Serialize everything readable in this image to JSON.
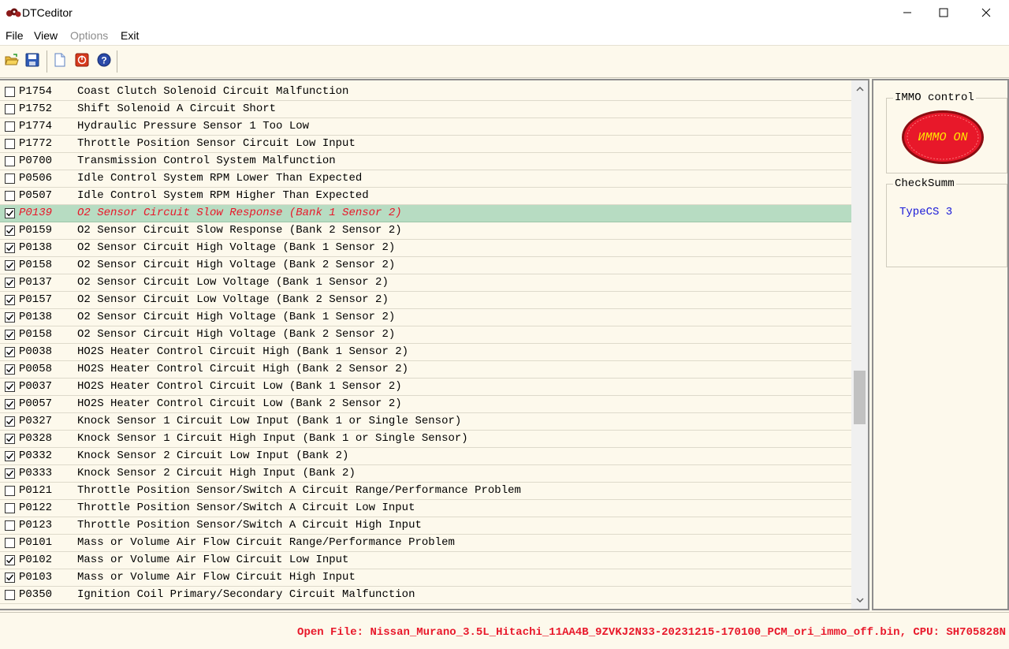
{
  "window": {
    "title": "DTCeditor"
  },
  "menu": [
    {
      "label": "File",
      "enabled": true
    },
    {
      "label": "View",
      "enabled": true
    },
    {
      "label": "Options",
      "enabled": false
    },
    {
      "label": "Exit",
      "enabled": true
    }
  ],
  "toolbar": {
    "buttons": [
      {
        "icon": "open-folder-icon"
      },
      {
        "icon": "save-icon"
      },
      {
        "icon": "new-document-icon"
      },
      {
        "icon": "stop-icon"
      },
      {
        "icon": "help-icon"
      }
    ]
  },
  "dtc_list": {
    "selected_index": 7,
    "rows": [
      {
        "code": "P1754",
        "description": "Coast Clutch Solenoid Circuit Malfunction",
        "checked": false
      },
      {
        "code": "P1752",
        "description": "Shift Solenoid A Circuit Short",
        "checked": false
      },
      {
        "code": "P1774",
        "description": "Hydraulic Pressure Sensor 1 Too Low",
        "checked": false
      },
      {
        "code": "P1772",
        "description": "Throttle Position Sensor Circuit Low Input",
        "checked": false
      },
      {
        "code": "P0700",
        "description": "Transmission Control System Malfunction",
        "checked": false
      },
      {
        "code": "P0506",
        "description": "Idle Control System RPM Lower Than Expected",
        "checked": false
      },
      {
        "code": "P0507",
        "description": "Idle Control System RPM Higher Than Expected",
        "checked": false
      },
      {
        "code": "P0139",
        "description": "O2 Sensor Circuit Slow Response (Bank 1 Sensor 2)",
        "checked": true
      },
      {
        "code": "P0159",
        "description": "O2 Sensor Circuit Slow Response (Bank 2 Sensor 2)",
        "checked": true
      },
      {
        "code": "P0138",
        "description": "O2 Sensor Circuit High Voltage (Bank 1 Sensor 2)",
        "checked": true
      },
      {
        "code": "P0158",
        "description": "O2 Sensor Circuit High Voltage (Bank 2 Sensor 2)",
        "checked": true
      },
      {
        "code": "P0137",
        "description": "O2 Sensor Circuit Low Voltage (Bank 1 Sensor 2)",
        "checked": true
      },
      {
        "code": "P0157",
        "description": "O2 Sensor Circuit Low Voltage (Bank 2 Sensor 2)",
        "checked": true
      },
      {
        "code": "P0138",
        "description": "O2 Sensor Circuit High Voltage (Bank 1 Sensor 2)",
        "checked": true
      },
      {
        "code": "P0158",
        "description": "O2 Sensor Circuit High Voltage (Bank 2 Sensor 2)",
        "checked": true
      },
      {
        "code": "P0038",
        "description": "HO2S Heater Control Circuit High (Bank 1 Sensor 2)",
        "checked": true
      },
      {
        "code": "P0058",
        "description": "HO2S Heater Control Circuit High (Bank 2 Sensor 2)",
        "checked": true
      },
      {
        "code": "P0037",
        "description": "HO2S Heater Control Circuit Low (Bank 1 Sensor 2)",
        "checked": true
      },
      {
        "code": "P0057",
        "description": "HO2S Heater Control Circuit Low (Bank 2 Sensor 2)",
        "checked": true
      },
      {
        "code": "P0327",
        "description": "Knock Sensor 1 Circuit Low Input (Bank 1 or Single Sensor)",
        "checked": true
      },
      {
        "code": "P0328",
        "description": "Knock Sensor 1 Circuit High Input (Bank 1 or Single Sensor)",
        "checked": true
      },
      {
        "code": "P0332",
        "description": "Knock Sensor 2 Circuit Low Input (Bank 2)",
        "checked": true
      },
      {
        "code": "P0333",
        "description": "Knock Sensor 2 Circuit High Input (Bank 2)",
        "checked": true
      },
      {
        "code": "P0121",
        "description": "Throttle Position Sensor/Switch A Circuit Range/Performance Problem",
        "checked": false
      },
      {
        "code": "P0122",
        "description": "Throttle Position Sensor/Switch A Circuit Low Input",
        "checked": false
      },
      {
        "code": "P0123",
        "description": "Throttle Position Sensor/Switch A Circuit High Input",
        "checked": false
      },
      {
        "code": "P0101",
        "description": "Mass or Volume Air Flow Circuit Range/Performance Problem",
        "checked": false
      },
      {
        "code": "P0102",
        "description": "Mass or Volume Air Flow Circuit Low Input",
        "checked": true
      },
      {
        "code": "P0103",
        "description": "Mass or Volume Air Flow Circuit High Input",
        "checked": true
      },
      {
        "code": "P0350",
        "description": "Ignition Coil Primary/Secondary Circuit Malfunction",
        "checked": false
      }
    ]
  },
  "immo_control": {
    "label": "IMMO control",
    "button_text": "ИММО  ON",
    "color": "#e8182a"
  },
  "checksum": {
    "label": "CheckSumm",
    "value": "TypeCS 3"
  },
  "status": {
    "text": "Open File: Nissan_Murano_3.5L_Hitachi_11AA4B_9ZVKJ2N33-20231215-170100_PCM_ori_immo_off.bin, CPU: SH705828N"
  },
  "colors": {
    "selected_row_bg": "#b7dcc2",
    "selected_row_text": "#e8182a",
    "status_text": "#e8182a",
    "checksum_text": "#1a1ad8",
    "background": "#fdf9ec"
  }
}
